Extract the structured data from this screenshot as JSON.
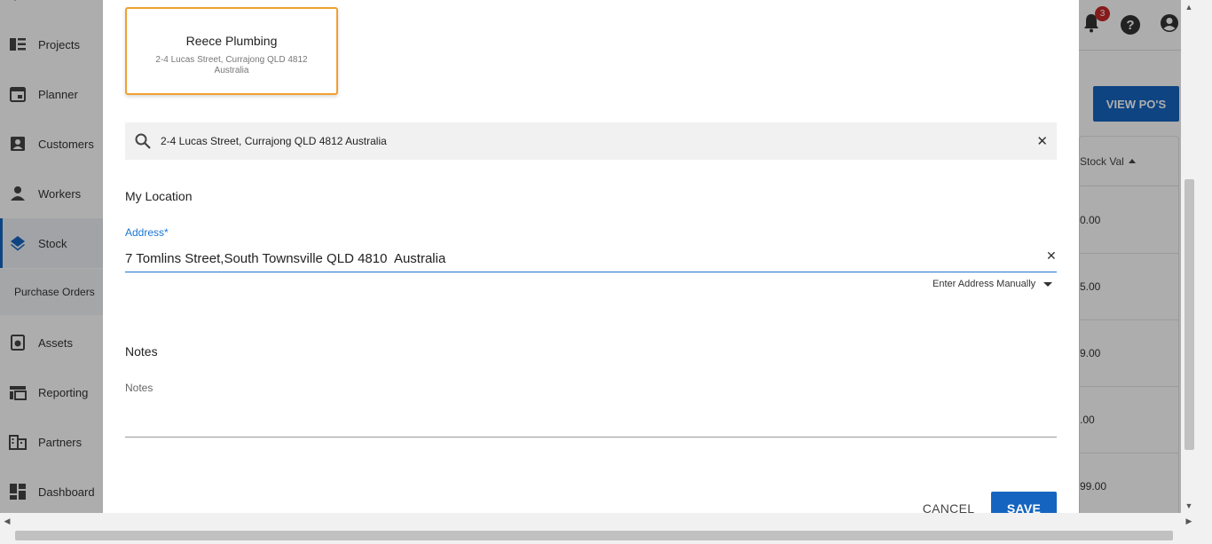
{
  "sidebar": {
    "items": [
      {
        "label": "Projects",
        "icon": "projects-icon"
      },
      {
        "label": "Planner",
        "icon": "calendar-icon"
      },
      {
        "label": "Customers",
        "icon": "customers-icon"
      },
      {
        "label": "Workers",
        "icon": "person-icon"
      },
      {
        "label": "Stock",
        "icon": "layers-icon",
        "active": true
      },
      {
        "label": "Assets",
        "icon": "assets-icon"
      },
      {
        "label": "Reporting",
        "icon": "table-icon"
      },
      {
        "label": "Partners",
        "icon": "building-icon"
      },
      {
        "label": "Dashboard",
        "icon": "dashboard-icon"
      }
    ],
    "sub_item": "Purchase Orders"
  },
  "topbar": {
    "notification_count": "3"
  },
  "background": {
    "view_pos_label": "VIEW PO'S",
    "column_header": "Stock Val",
    "cells": [
      "0.00",
      "5.00",
      "9.00",
      ".00",
      "99.00"
    ]
  },
  "modal": {
    "location_card": {
      "name": "Reece Plumbing",
      "address": "2-4 Lucas Street, Currajong QLD 4812 Australia"
    },
    "search": {
      "value": "2-4 Lucas Street, Currajong QLD 4812 Australia"
    },
    "my_location_heading": "My Location",
    "address_label": "Address*",
    "address_value": "7 Tomlins Street,South Townsville QLD 4810  Australia",
    "manual_toggle": "Enter Address Manually",
    "notes_heading": "Notes",
    "notes_label": "Notes",
    "cancel_label": "CANCEL",
    "save_label": "SAVE"
  },
  "colors": {
    "primary": "#1565c0",
    "accent_border": "#f0a030",
    "badge": "#c62828"
  }
}
